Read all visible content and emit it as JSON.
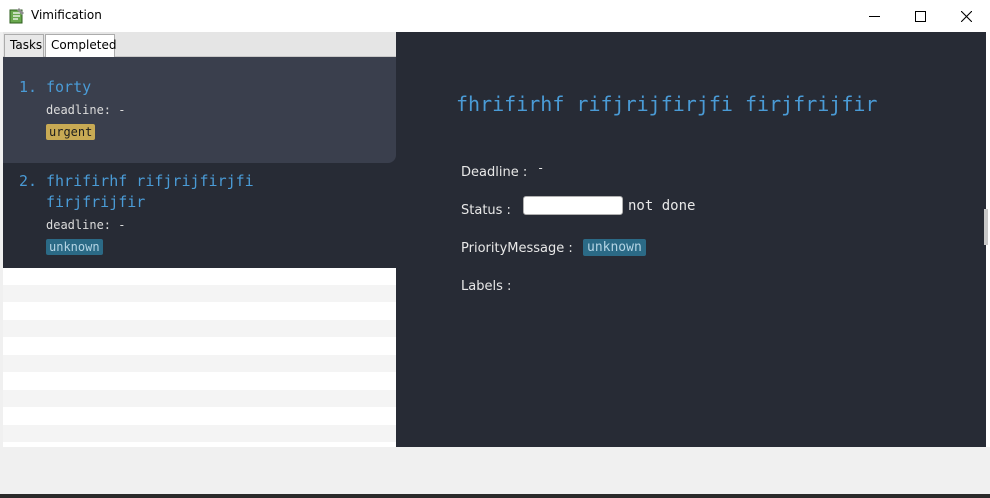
{
  "window": {
    "title": "Vimification",
    "controls": {
      "minimize": "minimize-icon",
      "maximize": "maximize-icon",
      "close": "close-icon"
    }
  },
  "tabs": [
    {
      "label": "Tasks",
      "active": false
    },
    {
      "label": "Completed",
      "active": true
    }
  ],
  "task_list": [
    {
      "index": "1.",
      "title_lines": [
        "forty"
      ],
      "deadline": "deadline: -",
      "priority": "urgent",
      "selected": true
    },
    {
      "index": "2.",
      "title_lines": [
        "fhrifirhf rifjrijfirjfi",
        "firjfrijfir"
      ],
      "deadline": "deadline: -",
      "priority": "unknown",
      "selected": false
    }
  ],
  "detail": {
    "title": "fhrifirhf rifjrijfirjfi firjfrijfir",
    "deadline_label": "Deadline :",
    "deadline_value": "-",
    "status_label": "Status :",
    "status_value": "not done",
    "priority_label": "PriorityMessage :",
    "priority_value": "unknown",
    "labels_label": "Labels :"
  },
  "colors": {
    "accent": "#4a9bd6",
    "panel_bg": "#272b35",
    "urgent_tag": "#c8aa54",
    "unknown_tag": "#2b6a86"
  }
}
